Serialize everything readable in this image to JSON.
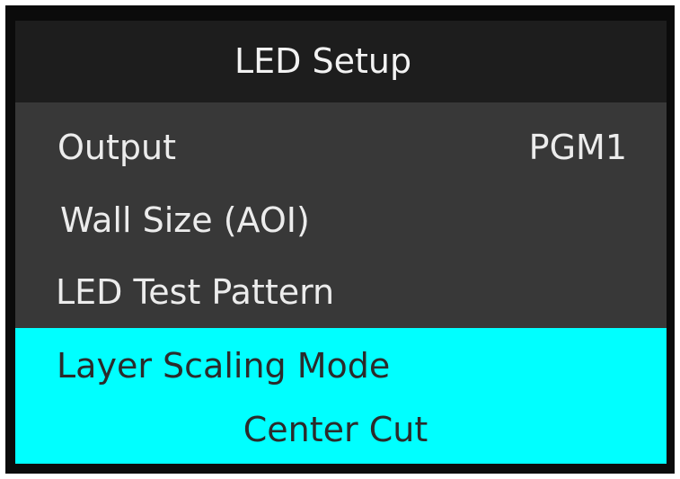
{
  "menu": {
    "title": "LED Setup",
    "items": [
      {
        "label": "Output",
        "value": "PGM1"
      },
      {
        "label": "Wall Size (AOI)",
        "value": ""
      },
      {
        "label": "LED Test Pattern",
        "value": ""
      }
    ],
    "selected_item": {
      "label": "Layer Scaling Mode",
      "value": "Center Cut"
    }
  },
  "colors": {
    "device_frame": "#0b0b0b",
    "title_bar_bg": "#1d1d1d",
    "menu_bg": "#383838",
    "highlight_bg": "#00ffff",
    "menu_text": "#ececec",
    "highlight_text": "#2b2b2b"
  }
}
